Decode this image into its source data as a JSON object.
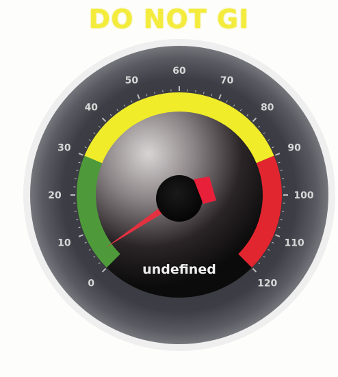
{
  "banner": {
    "text": "DO NOT GI"
  },
  "gauge": {
    "min": 0,
    "max": 120,
    "value": 5,
    "readout": "undefined",
    "ticks": [
      "0",
      "10",
      "20",
      "30",
      "40",
      "50",
      "60",
      "70",
      "80",
      "90",
      "100",
      "110",
      "120"
    ],
    "zones": [
      {
        "from": 0,
        "to": 30,
        "color": "#4e9a3a"
      },
      {
        "from": 30,
        "to": 90,
        "color": "#f0ec2a"
      },
      {
        "from": 90,
        "to": 120,
        "color": "#e2262f"
      }
    ],
    "needle_color": "#e43140",
    "marker_color": "#e8203a",
    "bezel_color": "#53545a",
    "face_color": "#0b0b0b"
  }
}
